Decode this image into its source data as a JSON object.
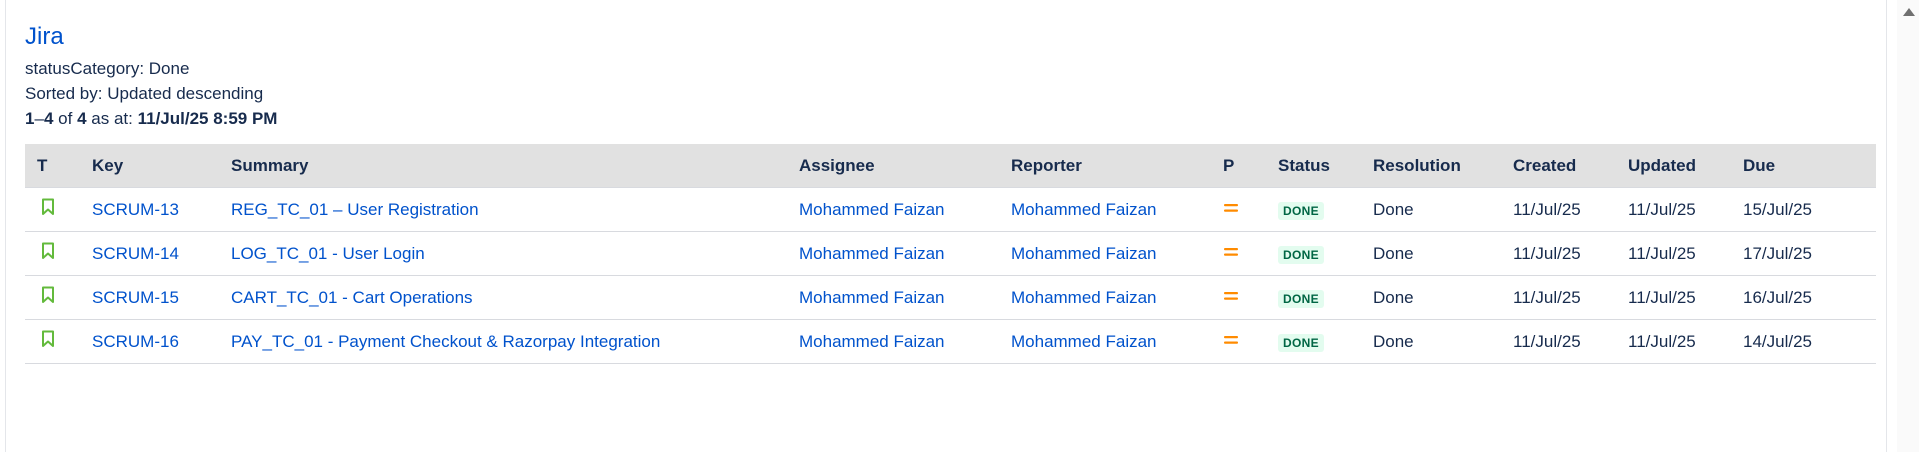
{
  "header": {
    "title": "Jira",
    "filter": "statusCategory: Done",
    "sort": "Sorted by: Updated descending",
    "range_start": "1",
    "range_end": "4",
    "of_text": "of",
    "total": "4",
    "as_at_text": "as at:",
    "timestamp": "11/Jul/25 8:59 PM"
  },
  "columns": [
    "T",
    "Key",
    "Summary",
    "Assignee",
    "Reporter",
    "P",
    "Status",
    "Resolution",
    "Created",
    "Updated",
    "Due"
  ],
  "rows": [
    {
      "type_icon": "story-bookmark-icon",
      "key": "SCRUM-13",
      "summary": "REG_TC_01 – User Registration",
      "assignee": "Mohammed Faizan",
      "reporter": "Mohammed Faizan",
      "priority_icon": "priority-medium-icon",
      "status": "DONE",
      "resolution": "Done",
      "created": "11/Jul/25",
      "updated": "11/Jul/25",
      "due": "15/Jul/25"
    },
    {
      "type_icon": "story-bookmark-icon",
      "key": "SCRUM-14",
      "summary": "LOG_TC_01 - User Login",
      "assignee": "Mohammed Faizan",
      "reporter": "Mohammed Faizan",
      "priority_icon": "priority-medium-icon",
      "status": "DONE",
      "resolution": "Done",
      "created": "11/Jul/25",
      "updated": "11/Jul/25",
      "due": "17/Jul/25"
    },
    {
      "type_icon": "story-bookmark-icon",
      "key": "SCRUM-15",
      "summary": "CART_TC_01 - Cart Operations",
      "assignee": "Mohammed Faizan",
      "reporter": "Mohammed Faizan",
      "priority_icon": "priority-medium-icon",
      "status": "DONE",
      "resolution": "Done",
      "created": "11/Jul/25",
      "updated": "11/Jul/25",
      "due": "16/Jul/25"
    },
    {
      "type_icon": "story-bookmark-icon",
      "key": "SCRUM-16",
      "summary": "PAY_TC_01 - Payment Checkout & Razorpay Integration",
      "assignee": "Mohammed Faizan",
      "reporter": "Mohammed Faizan",
      "priority_icon": "priority-medium-icon",
      "status": "DONE",
      "resolution": "Done",
      "created": "11/Jul/25",
      "updated": "11/Jul/25",
      "due": "14/Jul/25"
    }
  ],
  "colors": {
    "link": "#0052cc",
    "text": "#172b4d",
    "header_bg": "#e1e1e1",
    "story_icon": "#63ba3c",
    "priority_medium": "#ff8b00",
    "done_bg": "#e3fcef",
    "done_text": "#006644"
  }
}
